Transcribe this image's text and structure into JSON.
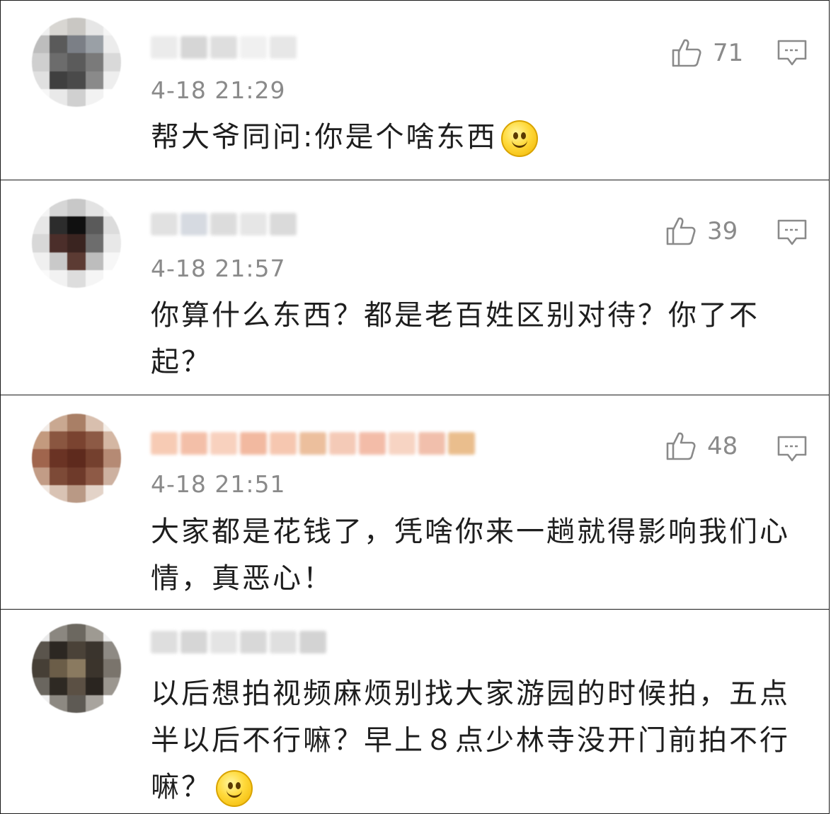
{
  "comments": [
    {
      "time": "4-18 21:29",
      "likes": "71",
      "text": "帮大爷同问:你是个啥东西",
      "has_emoji": true,
      "avatar_palette": [
        "#f0f0f0",
        "#d8d6d2",
        "#c9c7c3",
        "#e6e6e6",
        "#f5f5f5",
        "#bdbdbd",
        "#5a5a5a",
        "#7b7f86",
        "#9aa0a6",
        "#ececec",
        "#cfcfcf",
        "#6c6c6c",
        "#5b5b5b",
        "#7a7a7a",
        "#d9d9d9",
        "#e0e0e0",
        "#3f3f3f",
        "#4a4a4a",
        "#8a8a8a",
        "#eeeeee",
        "#f7f7f7",
        "#e9e9e9",
        "#d0d0d0",
        "#f2f2f2",
        "#ffffff"
      ],
      "name_palette": [
        "#e8e8e8",
        "#cfcfcf",
        "#d9d9d9",
        "#eeeeee",
        "#e3e3e3"
      ]
    },
    {
      "time": "4-18 21:57",
      "likes": "39",
      "text": "你算什么东西？都是老百姓区别对待？你了不起？",
      "has_emoji": false,
      "avatar_palette": [
        "#f4f4f4",
        "#d6d6d6",
        "#c8c8c8",
        "#e3e3e3",
        "#f5f5f5",
        "#e7e7e7",
        "#2c2c2c",
        "#101010",
        "#5a5a5a",
        "#dcdcdc",
        "#d8d8d8",
        "#4b2e2a",
        "#3a2420",
        "#6d6d6d",
        "#e8e8e8",
        "#f0f0f0",
        "#c9c9c9",
        "#5c3b33",
        "#bdbdbd",
        "#f7f7f7",
        "#fafafa",
        "#f2f2f2",
        "#ddd",
        "#f5f5f5",
        "#ffffff"
      ],
      "name_palette": [
        "#dcdcdc",
        "#cfd4dc",
        "#d7d7d7",
        "#e2e2e2",
        "#d4d4d4"
      ]
    },
    {
      "time": "4-18 21:51",
      "likes": "48",
      "text": "大家都是花钱了，凭啥你来一趟就得影响我们心情，真恶心！",
      "has_emoji": false,
      "avatar_palette": [
        "#f2ebe6",
        "#c9a891",
        "#a97f66",
        "#d8bfae",
        "#f5efe9",
        "#c39a7e",
        "#8a5640",
        "#7a4330",
        "#8d5a45",
        "#d4b7a3",
        "#a0654d",
        "#6a3324",
        "#5e2a1d",
        "#74402e",
        "#b58a74",
        "#c29c86",
        "#7d4a37",
        "#6e3a2a",
        "#8e5a46",
        "#cdb1a0",
        "#f1e7e0",
        "#d9c3b4",
        "#b99985",
        "#e3d3c8",
        "#ffffff"
      ],
      "name_palette": [
        "#f6c2a8",
        "#f2b59a",
        "#f7c9b3",
        "#f0ad90",
        "#f5bea3",
        "#e9b48c",
        "#f3c1ab",
        "#f1b19a",
        "#f6cdb9",
        "#efb59e",
        "#e7b37a"
      ]
    },
    {
      "time": "",
      "likes": "",
      "text": "以后想拍视频麻烦别找大家游园的时候拍，五点半以后不行嘛？早上８点少林寺没开门前拍不行嘛？",
      "has_emoji": true,
      "avatar_palette": [
        "#e9e9e9",
        "#8b8780",
        "#6c6860",
        "#9e9a92",
        "#f1f1f1",
        "#5a544c",
        "#2c2722",
        "#4a4238",
        "#3a342d",
        "#8e8a84",
        "#463f36",
        "#6b5d48",
        "#8a7a60",
        "#3b342c",
        "#7a746c",
        "#6a665f",
        "#2e2923",
        "#5b5044",
        "#2a2520",
        "#9b968f",
        "#f0f0f0",
        "#8d8982",
        "#5e5a54",
        "#a8a49e",
        "#ffffff"
      ],
      "name_palette": [
        "#d9d9d9",
        "#cfcfcf",
        "#e0e0e0",
        "#d2d2d2",
        "#dadada",
        "#cccccc"
      ]
    }
  ],
  "icons": {
    "like": "thumbs-up-icon",
    "reply": "comment-icon"
  },
  "colors": {
    "border": "#1a1a1a",
    "meta_gray": "#8a8a8a",
    "text": "#1e1e1e"
  }
}
